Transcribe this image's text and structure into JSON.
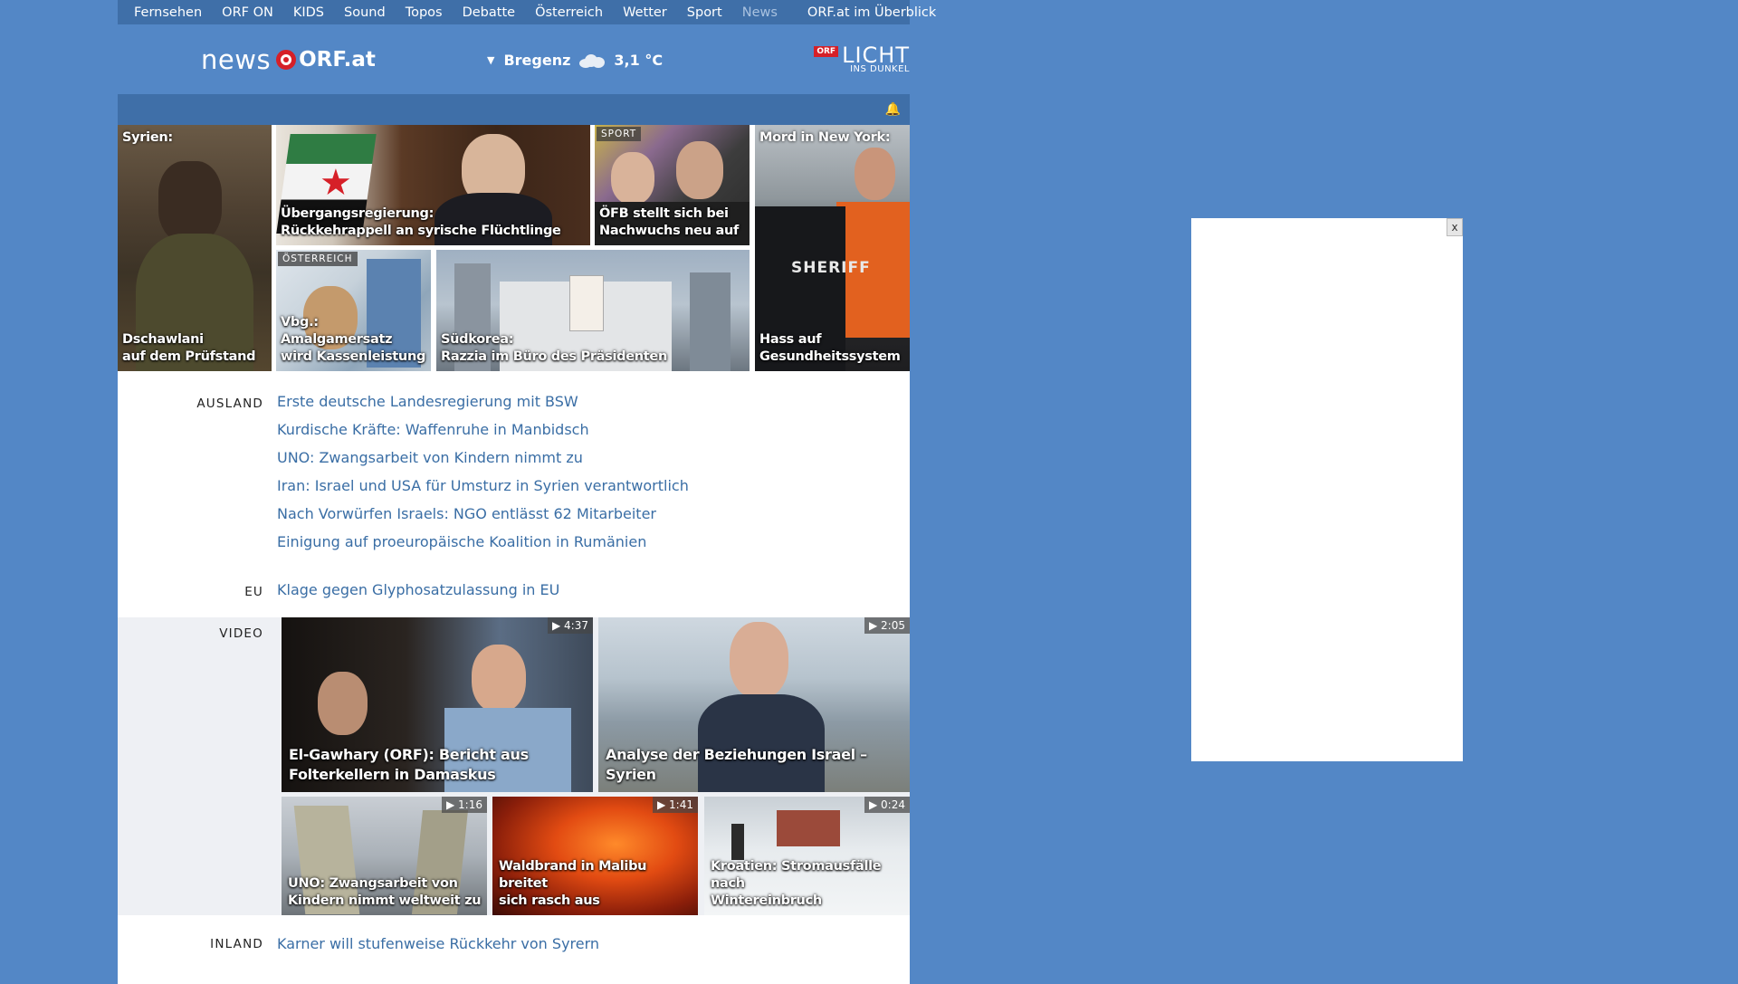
{
  "nav": {
    "items": [
      "Fernsehen",
      "ORF ON",
      "KIDS",
      "Sound",
      "Topos",
      "Debatte",
      "Österreich",
      "Wetter",
      "Sport",
      "News"
    ],
    "overview": "ORF.at im Überblick"
  },
  "header": {
    "logo_news": "news",
    "logo_orf": "ORF.at",
    "weather_city": "Bregenz",
    "weather_temp": "3,1 °C",
    "weather_icon": "cloud-icon",
    "licht_badge": "ORF",
    "licht_title": "LICHT",
    "licht_sub": "INS DUNKEL"
  },
  "teasers": {
    "syrien_top": "Syrien:",
    "syrien_bottom_1": "Dschawlani",
    "syrien_bottom_2": "auf dem Prüfstand",
    "regierung_1": "Übergangsregierung:",
    "regierung_2": "Rückkehrappell an syrische Flüchtlinge",
    "sport_tag": "SPORT",
    "sport_1": "ÖFB stellt sich bei",
    "sport_2": "Nachwuchs neu auf",
    "ny_top": "Mord in New York:",
    "ny_bottom_1": "Hass auf",
    "ny_bottom_2": "Gesundheitssystem",
    "oe_tag": "ÖSTERREICH",
    "vbg_1": "Vbg.: Amalgamersatz",
    "vbg_2": "wird Kassenleistung",
    "korea_1": "Südkorea:",
    "korea_2": "Razzia im Büro des Präsidenten"
  },
  "ausland": {
    "label": "AUSLAND",
    "links": [
      "Erste deutsche Landesregierung mit BSW",
      "Kurdische Kräfte: Waffenruhe in Manbidsch",
      "UNO: Zwangsarbeit von Kindern nimmt zu",
      "Iran: Israel und USA für Umsturz in Syrien verantwortlich",
      "Nach Vorwürfen Israels: NGO entlässt 62 Mitarbeiter",
      "Einigung auf proeuropäische Koalition in Rumänien"
    ]
  },
  "eu": {
    "label": "EU",
    "links": [
      "Klage gegen Glyphosatzulassung in EU"
    ]
  },
  "video": {
    "label": "VIDEO",
    "items": [
      {
        "dur": "▶ 4:37",
        "cap1": "El-Gawhary (ORF): Bericht aus",
        "cap2": "Folterkellern in Damaskus"
      },
      {
        "dur": "▶ 2:05",
        "cap1": "Analyse der Beziehungen Israel – Syrien",
        "cap2": ""
      },
      {
        "dur": "▶ 1:16",
        "cap1": "UNO: Zwangsarbeit von",
        "cap2": "Kindern nimmt weltweit zu"
      },
      {
        "dur": "▶ 1:41",
        "cap1": "Waldbrand in Malibu breitet",
        "cap2": "sich rasch aus"
      },
      {
        "dur": "▶ 0:24",
        "cap1": "Kroatien: Stromausfälle nach",
        "cap2": "Wintereinbruch"
      }
    ]
  },
  "inland": {
    "label": "INLAND",
    "links": [
      "Karner will stufenweise Rückkehr von Syrern"
    ]
  },
  "ad": {
    "close": "x"
  },
  "colors": {
    "page_bg": "#5387c6",
    "bar": "#3f6fa8",
    "link": "#3a6ea5",
    "orf_red": "#d62028"
  }
}
